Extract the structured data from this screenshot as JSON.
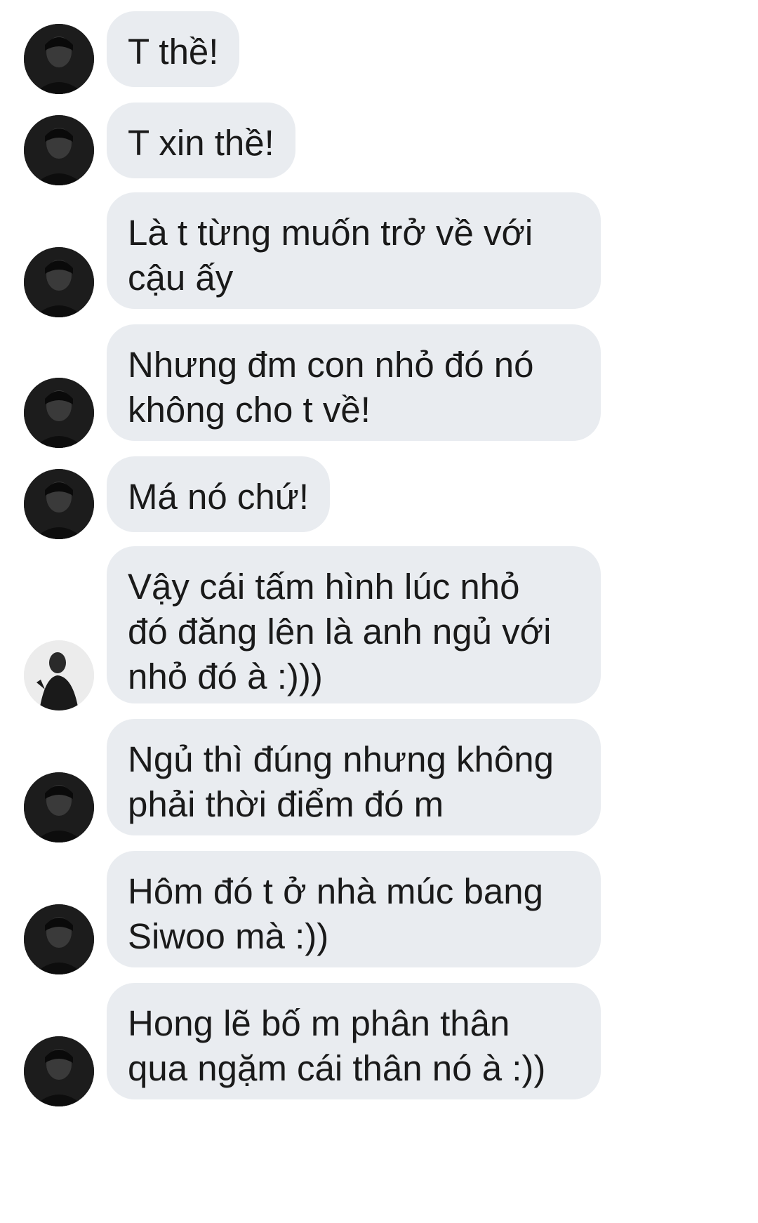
{
  "conversation": {
    "messages": [
      {
        "text": "T thề!",
        "avatar": "person-dark-avatar-icon"
      },
      {
        "text": "T xin thề!",
        "avatar": "person-dark-avatar-icon"
      },
      {
        "text": "Là t từng muốn trở về với\ncậu ấy",
        "avatar": "person-dark-avatar-icon"
      },
      {
        "text": "Nhưng đm con nhỏ đó nó\nkhông cho t về!",
        "avatar": "person-dark-avatar-icon"
      },
      {
        "text": "Má nó chứ!",
        "avatar": "person-dark-avatar-icon"
      },
      {
        "text": "Vậy cái tấm hình lúc nhỏ\nđó đăng lên là anh ngủ với\nnhỏ đó à :)))",
        "avatar": "person-light-avatar-icon"
      },
      {
        "text": "Ngủ thì đúng nhưng không\nphải thời điểm đó m",
        "avatar": "person-dark-avatar-icon"
      },
      {
        "text": "Hôm đó t ở nhà múc bang\nSiwoo mà :))",
        "avatar": "person-dark-avatar-icon"
      },
      {
        "text": "Hong lẽ bố m phân thân\nqua ngặm cái thân nó à :))",
        "avatar": "person-dark-avatar-icon"
      }
    ]
  },
  "colors": {
    "bubble": "#e9ecf0",
    "text": "#1a1a1a",
    "background": "#ffffff"
  }
}
